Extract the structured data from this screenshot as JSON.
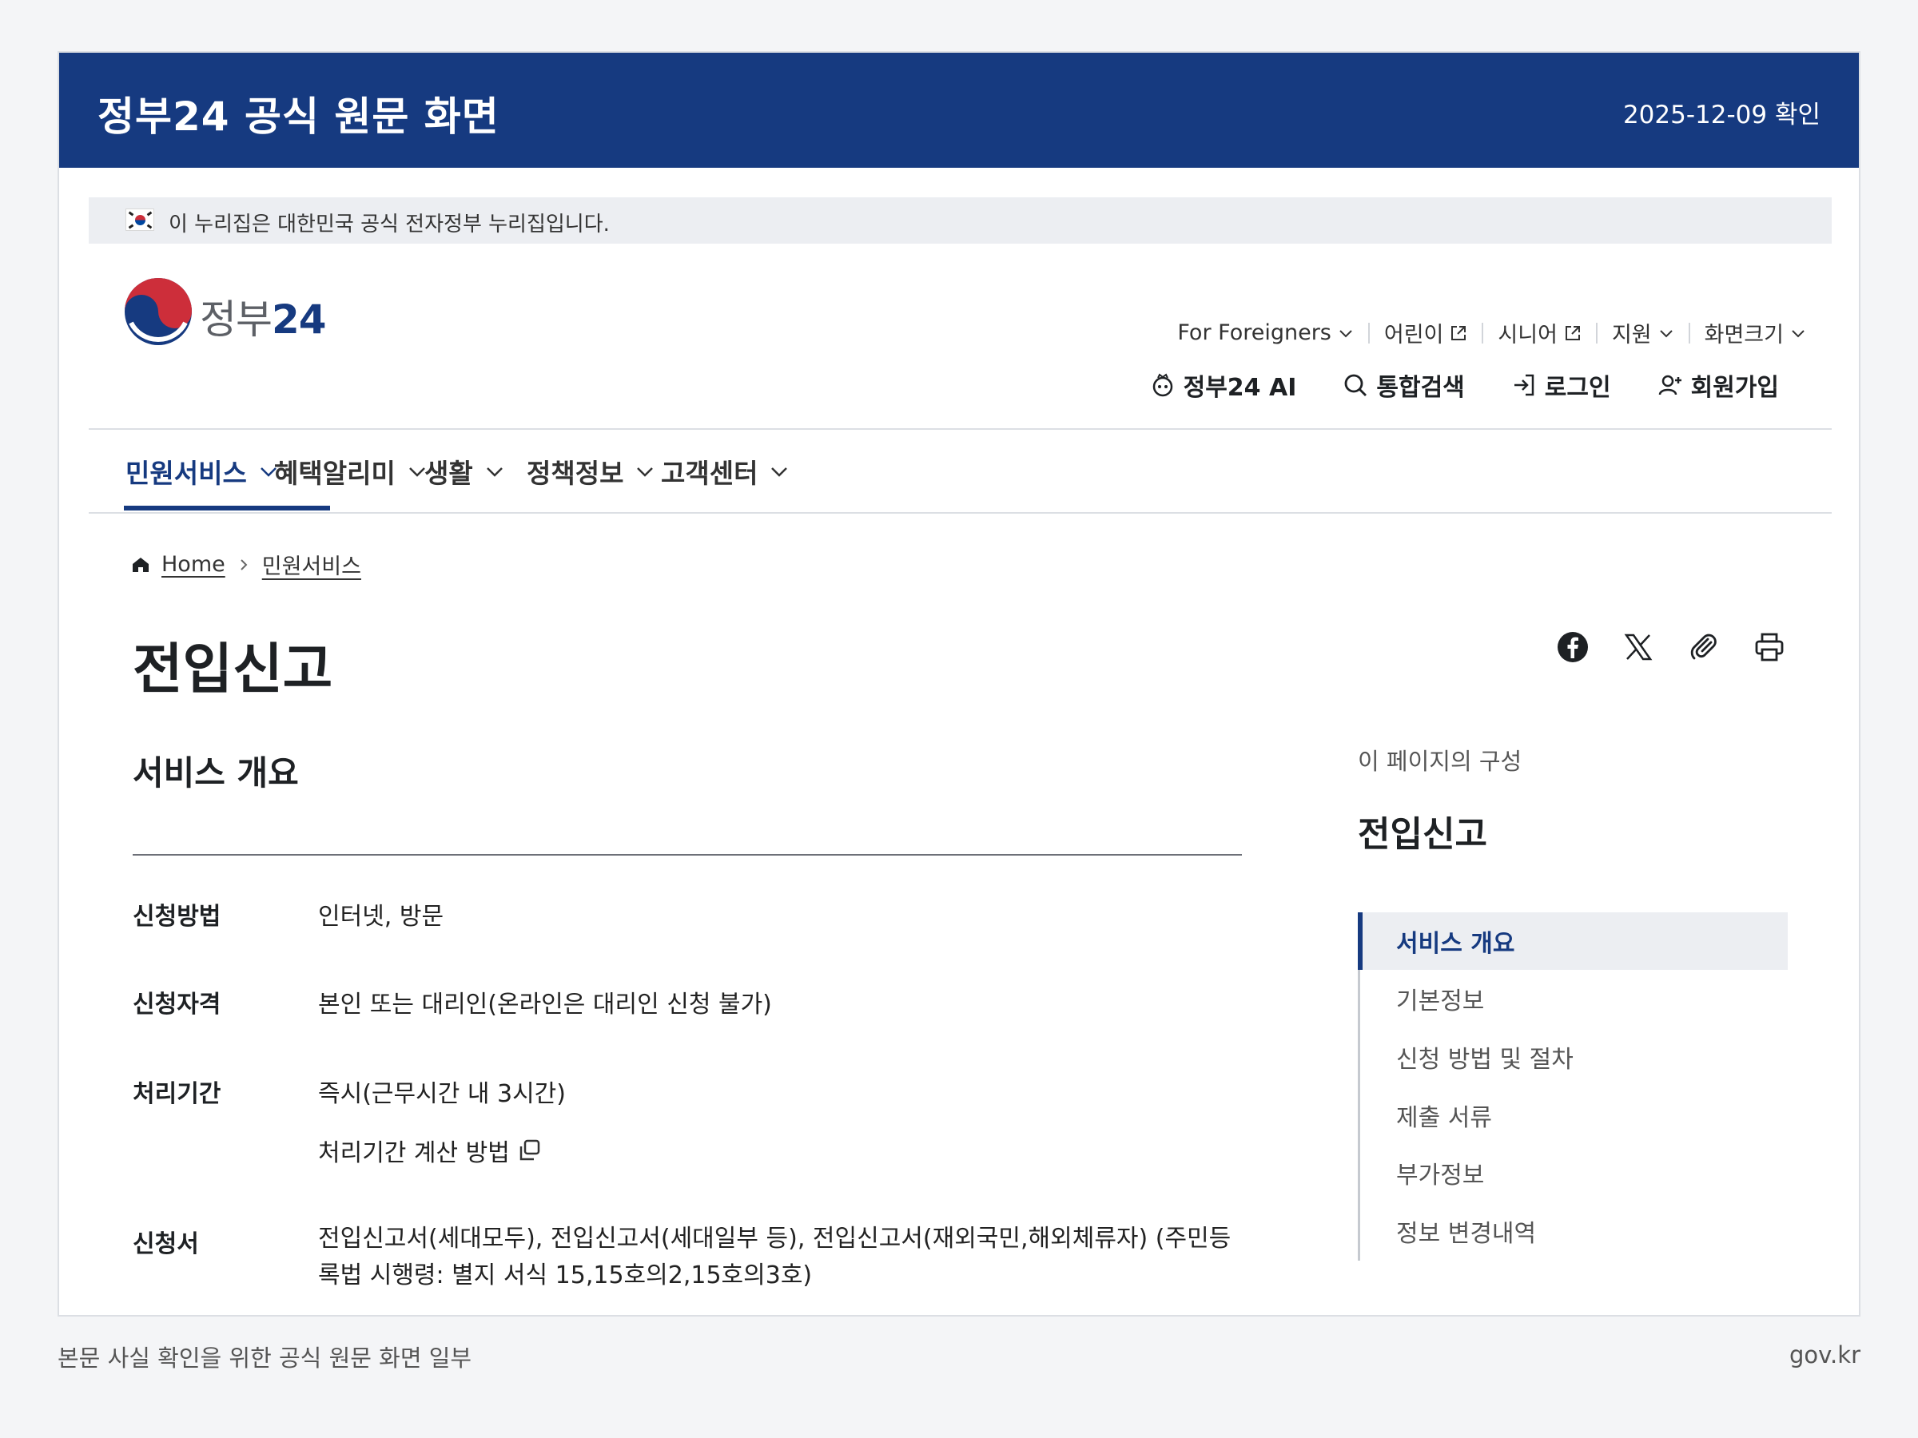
{
  "frame": {
    "title": "정부24 공식 원문 화면",
    "date": "2025-12-09 확인"
  },
  "gov_banner": {
    "text": "이 누리집은 대한민국 공식 전자정부 누리집입니다."
  },
  "logo": {
    "name": "정부",
    "number": "24"
  },
  "util_nav": [
    {
      "label": "For Foreigners",
      "icon": "chevron-down-icon"
    },
    {
      "label": "어린이",
      "icon": "external-link-icon"
    },
    {
      "label": "시니어",
      "icon": "external-link-icon"
    },
    {
      "label": "지원",
      "icon": "chevron-down-icon"
    },
    {
      "label": "화면크기",
      "icon": "chevron-down-icon"
    }
  ],
  "main_util": [
    {
      "label": "정부24 AI",
      "icon": "ai-bot-icon"
    },
    {
      "label": "통합검색",
      "icon": "search-icon"
    },
    {
      "label": "로그인",
      "icon": "login-icon"
    },
    {
      "label": "회원가입",
      "icon": "user-add-icon"
    }
  ],
  "gnb": [
    {
      "label": "민원서비스",
      "active": true
    },
    {
      "label": "혜택알리미",
      "active": false
    },
    {
      "label": "생활",
      "active": false
    },
    {
      "label": "정책정보",
      "active": false
    },
    {
      "label": "고객센터",
      "active": false
    }
  ],
  "breadcrumb": {
    "home": "Home",
    "current": "민원서비스"
  },
  "page": {
    "title": "전입신고",
    "section_title": "서비스 개요"
  },
  "share_tools": [
    "facebook-icon",
    "x-icon",
    "link-clip-icon",
    "print-icon"
  ],
  "info": {
    "method_label": "신청방법",
    "method_value": "인터넷, 방문",
    "eligibility_label": "신청자격",
    "eligibility_value": "본인 또는 대리인(온라인은 대리인 신청 불가)",
    "period_label": "처리기간",
    "period_value": "즉시(근무시간 내 3시간)",
    "period_link": "처리기간 계산 방법",
    "form_label": "신청서",
    "form_value": "전입신고서(세대모두), 전입신고서(세대일부 등), 전입신고서(재외국민,해외체류자) (주민등록법 시행령: 별지 서식 15,15호의2,15호의3호)"
  },
  "toc": {
    "caption": "이 페이지의 구성",
    "title": "전입신고",
    "items": [
      {
        "label": "서비스 개요",
        "active": true
      },
      {
        "label": "기본정보",
        "active": false
      },
      {
        "label": "신청 방법 및 절차",
        "active": false
      },
      {
        "label": "제출 서류",
        "active": false
      },
      {
        "label": "부가정보",
        "active": false
      },
      {
        "label": "정보 변경내역",
        "active": false
      }
    ]
  },
  "footer": {
    "caption": "본문 사실 확인을 위한 공식 원문 화면 일부",
    "source": "gov.kr"
  },
  "colors": {
    "header_blue": "#163a80",
    "cta_blue": "#256ef4",
    "logo_red": "#cd2e3a",
    "background": "#f4f5f7"
  }
}
